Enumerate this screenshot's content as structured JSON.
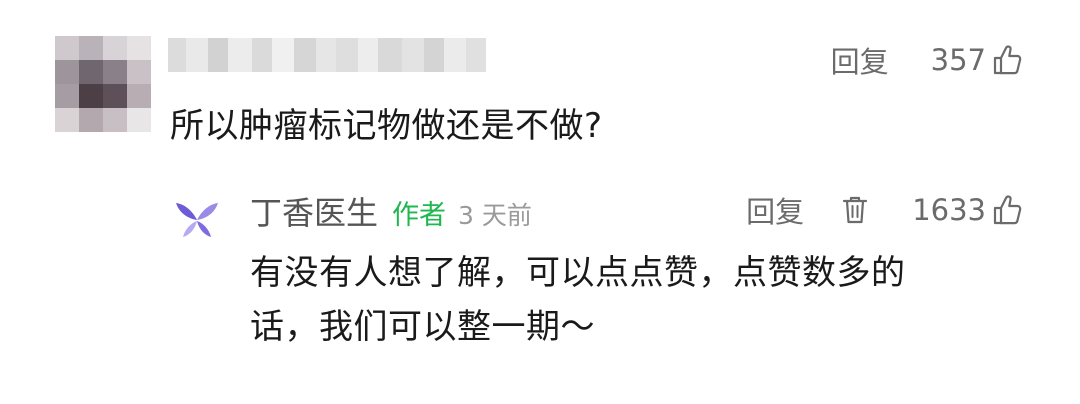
{
  "comment": {
    "reply_label": "回复",
    "like_count": "357",
    "text": "所以肿瘤标记物做还是不做?"
  },
  "reply": {
    "author": "丁香医生",
    "author_badge": "作者",
    "time": "3 天前",
    "reply_label": "回复",
    "like_count": "1633",
    "text_lines": [
      "有没有人想了解，可以点点赞，点赞数多的",
      "话，我们可以整一期～"
    ]
  },
  "icons": {
    "like": "thumbs-up-icon",
    "delete": "trash-icon",
    "avatar": "butterfly-logo-icon"
  },
  "colors": {
    "author_badge": "#1fb74f",
    "secondary_text": "#6b6b6b",
    "logo_purple": "#7b5bd6"
  }
}
